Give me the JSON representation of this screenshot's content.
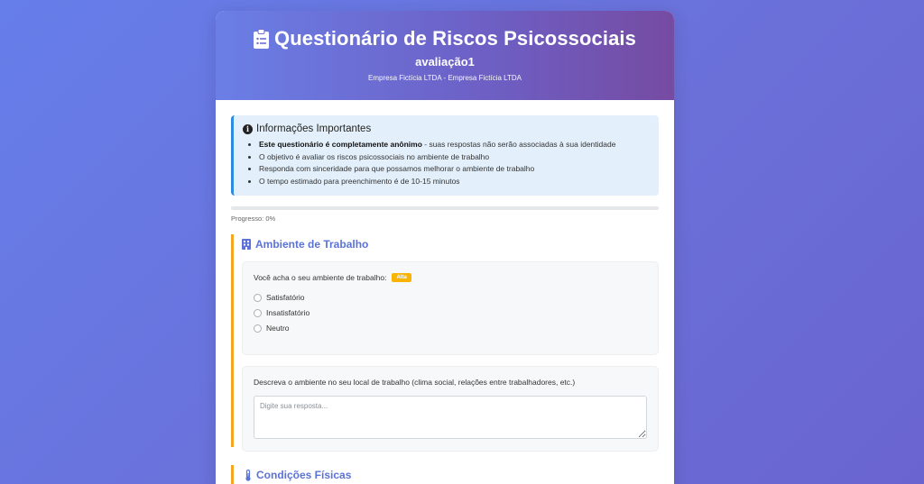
{
  "header": {
    "title": "Questionário de Riscos Psicossociais",
    "subtitle": "avaliação1",
    "company": "Empresa Fictícia LTDA - Empresa Fictícia LTDA",
    "icon": "clipboard-list-icon"
  },
  "info": {
    "icon": "info-circle-icon",
    "title": "Informações Importantes",
    "item1_bold": "Este questionário é completamente anônimo",
    "item1_rest": " - suas respostas não serão associadas à sua identidade",
    "item2": "O objetivo é avaliar os riscos psicossociais no ambiente de trabalho",
    "item3": "Responda com sinceridade para que possamos melhorar o ambiente de trabalho",
    "item4": "O tempo estimado para preenchimento é de 10-15 minutos",
    "accent_color": "#2f8be0"
  },
  "progress": {
    "label": "Progresso: 0%",
    "value": 0
  },
  "section1": {
    "icon": "building-icon",
    "title": "Ambiente de Trabalho",
    "q1": {
      "label": "Você acha o seu ambiente de trabalho:",
      "badge": "Alta",
      "options": [
        "Satisfatório",
        "Insatisfatório",
        "Neutro"
      ]
    },
    "q2": {
      "label": "Descreva o ambiente no seu local de trabalho (clima social, relações entre trabalhadores, etc.)",
      "placeholder": "Digite sua resposta..."
    }
  },
  "section2": {
    "icon": "thermometer-icon",
    "title": "Condições Físicas"
  },
  "colors": {
    "primary": "#667eea",
    "header_end": "#764ba2",
    "section_accent": "#f5a623",
    "badge": "#f8b400"
  }
}
